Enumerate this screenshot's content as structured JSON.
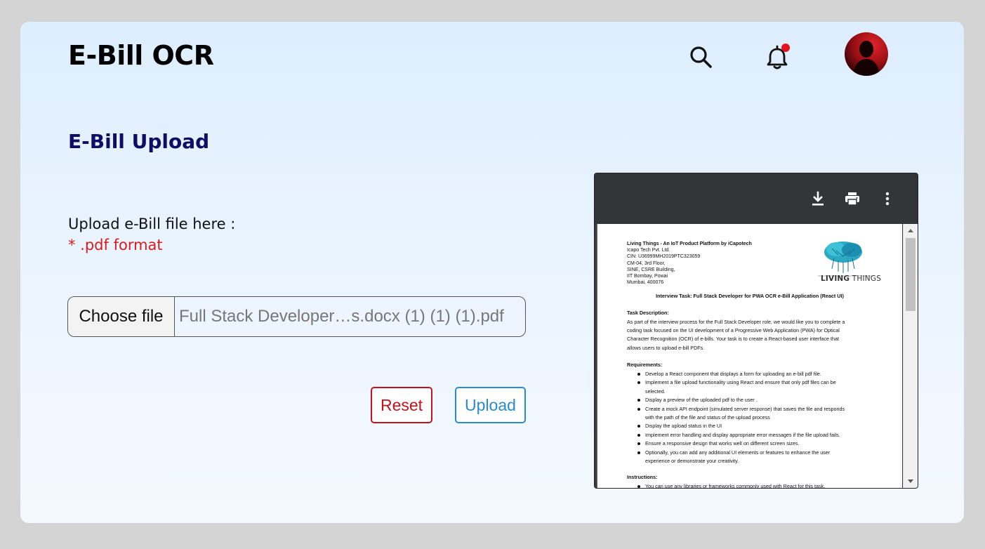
{
  "header": {
    "app_title": "E-Bill OCR",
    "icons": [
      "search-icon",
      "bell-icon",
      "avatar"
    ],
    "notification_dot_color": "#e3131f"
  },
  "main": {
    "section_title": "E-Bill Upload",
    "upload_label": "Upload e-Bill file here :",
    "format_note": "* .pdf format",
    "file_input": {
      "button_label": "Choose file",
      "file_name": "Full Stack Developer…s.docx (1) (1) (1).pdf"
    },
    "buttons": {
      "reset_label": "Reset",
      "upload_label": "Upload"
    },
    "colors": {
      "title": "#0d0d66",
      "reset": "#c4121f",
      "upload": "#2a8ad0",
      "format_note": "#d81c1c"
    }
  },
  "pdf_viewer": {
    "toolbar_icons": [
      "download-icon",
      "print-icon",
      "more-vert-icon"
    ],
    "document": {
      "company_lines": [
        "Living Things - An IoT Product Platform by iCapotech",
        "Icapo Tech Pvt. Ltd.",
        "CIN: U36999MH2019PTC323059",
        "CM-04, 3rd Floor,",
        "SINE, CSRE Building,",
        "IIT Bombay, Powai",
        "Mumbai, 400076"
      ],
      "logo_text_bold": "LIVING",
      "logo_text_light": "THINGS",
      "title": "Interview Task: Full Stack Developer for PWA OCR e-Bill Application (React UI)",
      "task_heading": "Task Description:",
      "task_lines": [
        "As part of the interview process for the Full Stack Developer role, we would like you to complete a",
        "coding task focused on the UI development of a Progressive Web Application (PWA) for Optical",
        "Character Recognition (OCR) of e-bills. Your task is to create a React-based user interface that",
        "allows users to upload e-bill PDFs."
      ],
      "requirements_heading": "Requirements:",
      "requirements": [
        "Develop a React component that displays a form for uploading an e-bill pdf file.",
        "Implement a file upload functionality using React and ensure that only pdf files can be",
        "selected.",
        "Display a preview of the uploaded pdf to the user .",
        "Create a mock API endpoint (simulated server response) that saves the file and responds",
        "with the path of the file and status of the upload process",
        "Display the upload status in the UI",
        "Implement error handling and display appropriate error messages if the file upload fails.",
        "Ensure a responsive design that works well on different screen sizes.",
        "Optionally, you can add any additional UI elements or features to enhance the user",
        "experience or demonstrate your creativity."
      ],
      "instructions_heading": "Instructions:",
      "instructions": [
        "You can use any libraries or frameworks commonly used with React for this task."
      ]
    }
  }
}
